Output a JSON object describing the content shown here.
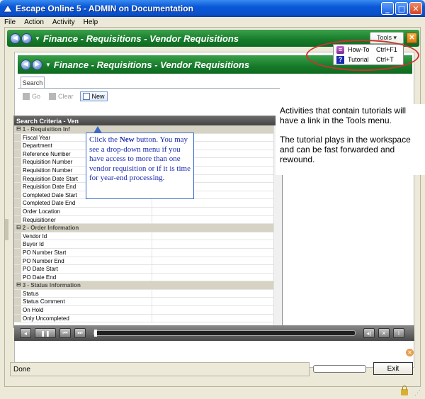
{
  "window": {
    "title": "Escape Online 5 - ADMIN on Documentation",
    "min": "_",
    "max": "□",
    "close": "✕"
  },
  "menu": [
    "File",
    "Action",
    "Activity",
    "Help"
  ],
  "outer": {
    "breadcrumb": "Finance - Requisitions - Vendor Requisitions",
    "tools_label": "Tools ▾",
    "close": "✕"
  },
  "tools_menu": {
    "items": [
      {
        "label": "How-To",
        "shortcut": "Ctrl+F1",
        "icon": "howto-book-icon"
      },
      {
        "label": "Tutorial",
        "shortcut": "Ctrl+T",
        "icon": "help-question-icon"
      }
    ]
  },
  "inner": {
    "breadcrumb": "Finance - Requisitions - Vendor Requisitions"
  },
  "tabs": {
    "search": "Search"
  },
  "toolbar": {
    "go": "Go",
    "clear": "Clear",
    "new": "New"
  },
  "grid": {
    "header": "Search Criteria - Ven",
    "rows": [
      {
        "section": true,
        "toggle": "⊟",
        "label": "1 - Requisition Inf"
      },
      {
        "label": "Fiscal Year"
      },
      {
        "label": "Department"
      },
      {
        "label": "Reference Number"
      },
      {
        "label": "Requisition Number"
      },
      {
        "label": "Requisition Number"
      },
      {
        "label": "Requisition Date Start"
      },
      {
        "label": "Requisition Date End"
      },
      {
        "label": "Completed Date Start"
      },
      {
        "label": "Completed Date End"
      },
      {
        "label": "Order Location"
      },
      {
        "label": "Requisitioner"
      },
      {
        "section": true,
        "toggle": "⊟",
        "label": "2 - Order Information"
      },
      {
        "label": "Vendor Id"
      },
      {
        "label": "Buyer Id"
      },
      {
        "label": "PO Number Start"
      },
      {
        "label": "PO Number End"
      },
      {
        "label": "PO Date Start"
      },
      {
        "label": "PO Date End"
      },
      {
        "section": true,
        "toggle": "⊟",
        "label": "3 - Status Information"
      },
      {
        "label": "Status"
      },
      {
        "label": "Status Comment"
      },
      {
        "label": "On Hold"
      },
      {
        "label": "Only Uncompleted"
      }
    ]
  },
  "callout": {
    "text_before": "Click the ",
    "bold": "New",
    "text_after": " button.  You may see a drop-down menu if you have access to more than one vendor requisition or if it is time for year-end processing."
  },
  "note": {
    "p1": "Activities that contain tutorials will have a link in the Tools menu.",
    "p2": "The tutorial plays in the workspace and can be fast forwarded and rewound."
  },
  "player": {
    "back": "◂",
    "pause": "❚❚",
    "rew": "⏮",
    "ff": "⏭",
    "volume": "◂)",
    "stop": "✕",
    "info": "i"
  },
  "status": {
    "text": "Done"
  },
  "exit": "Exit"
}
